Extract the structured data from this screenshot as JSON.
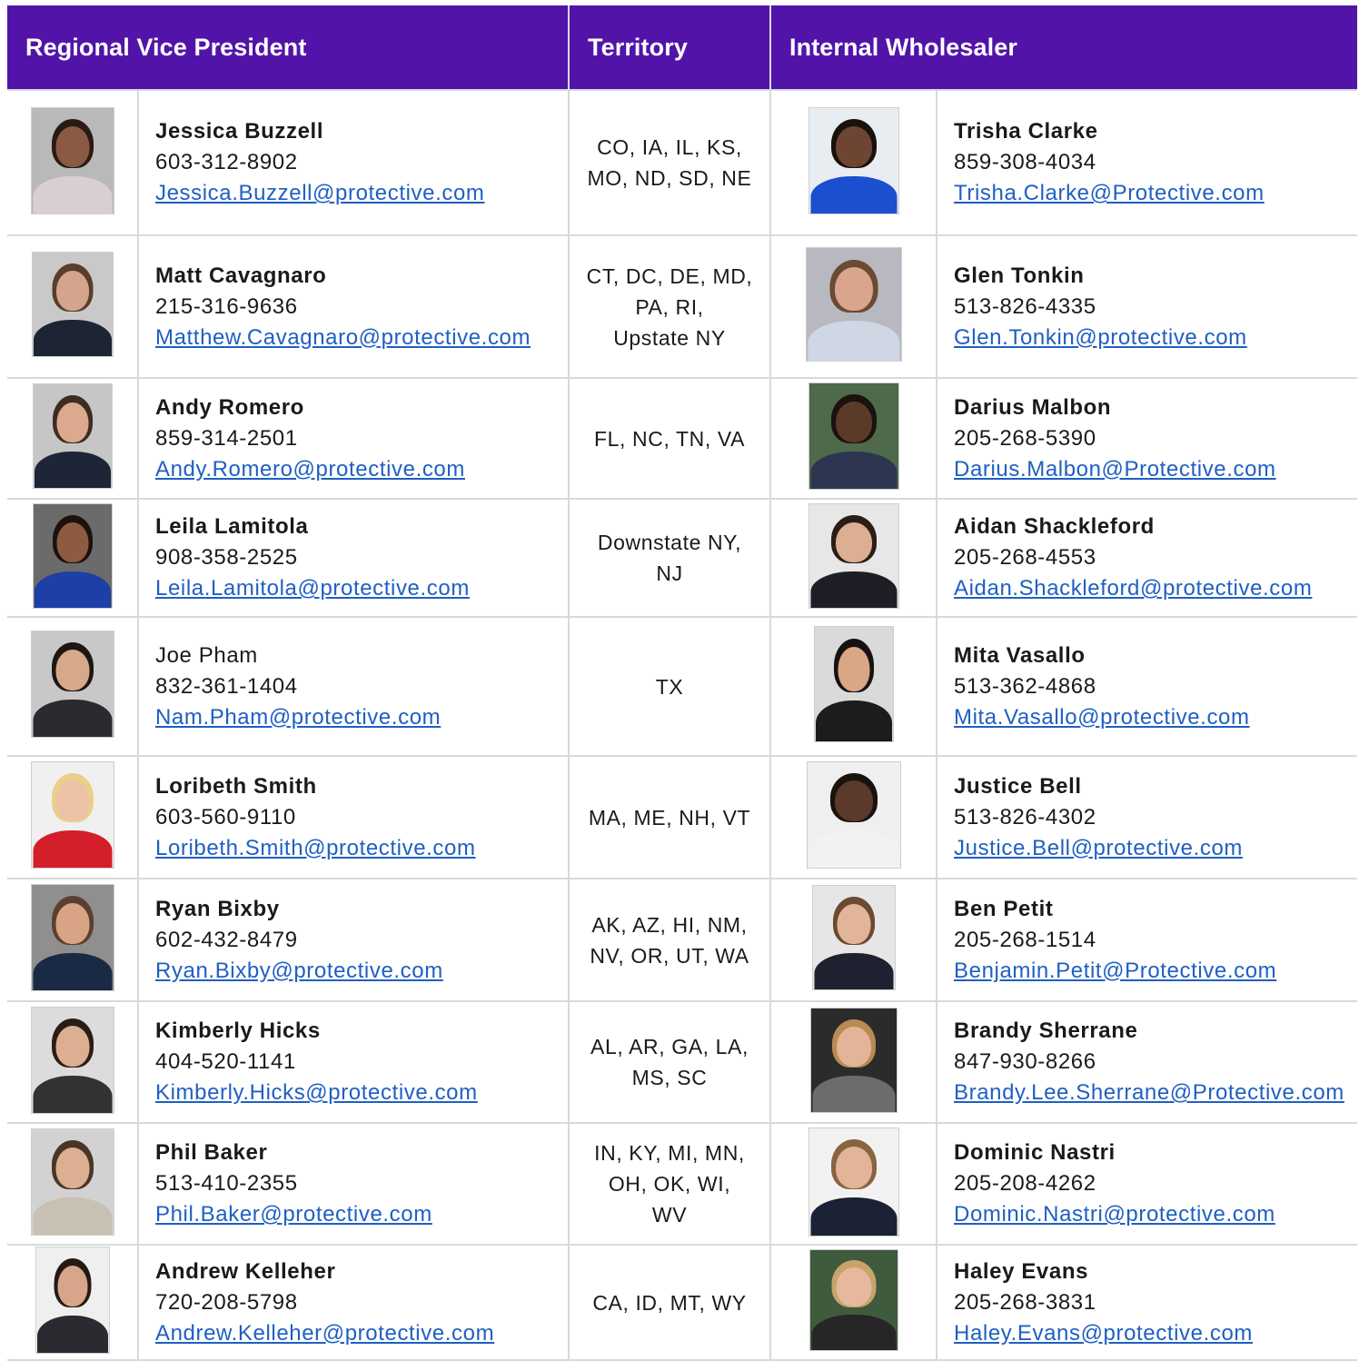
{
  "header": {
    "rvp": "Regional Vice President",
    "territory": "Territory",
    "iw": "Internal Wholesaler"
  },
  "rows": [
    {
      "rvp": {
        "name": "Jessica Buzzell",
        "phone": "603-312-8902",
        "email": "Jessica.Buzzell@protective.com"
      },
      "territory": [
        "CO, IA, IL, KS,",
        "MO, ND, SD, NE"
      ],
      "iw": {
        "name": "Trisha Clarke",
        "phone": "859-308-4034",
        "email": "Trisha.Clarke@Protective.com"
      }
    },
    {
      "rvp": {
        "name": "Matt Cavagnaro",
        "phone": "215-316-9636",
        "email": "Matthew.Cavagnaro@protective.com"
      },
      "territory": [
        "CT, DC, DE, MD,",
        "PA, RI,",
        "Upstate NY"
      ],
      "iw": {
        "name": "Glen Tonkin",
        "phone": "513-826-4335",
        "email": "Glen.Tonkin@protective.com"
      }
    },
    {
      "rvp": {
        "name": "Andy Romero",
        "phone": "859-314-2501",
        "email": "Andy.Romero@protective.com"
      },
      "territory": [
        "FL, NC, TN, VA"
      ],
      "iw": {
        "name": "Darius Malbon",
        "phone": "205-268-5390",
        "email": "Darius.Malbon@Protective.com"
      }
    },
    {
      "rvp": {
        "name": "Leila Lamitola",
        "phone": "908-358-2525",
        "email": "Leila.Lamitola@protective.com"
      },
      "territory": [
        "Downstate NY,",
        "NJ"
      ],
      "iw": {
        "name": "Aidan Shackleford",
        "phone": "205-268-4553",
        "email": "Aidan.Shackleford@protective.com"
      }
    },
    {
      "rvp": {
        "name": "Joe Pham",
        "phone": "832-361-1404",
        "email": "Nam.Pham@protective.com"
      },
      "territory": [
        "TX"
      ],
      "iw": {
        "name": "Mita Vasallo",
        "phone": "513-362-4868",
        "email": "Mita.Vasallo@protective.com"
      }
    },
    {
      "rvp": {
        "name": "Loribeth Smith",
        "phone": "603-560-9110",
        "email": "Loribeth.Smith@protective.com"
      },
      "territory": [
        "MA, ME, NH, VT"
      ],
      "iw": {
        "name": "Justice Bell",
        "phone": "513-826-4302",
        "email": "Justice.Bell@protective.com"
      }
    },
    {
      "rvp": {
        "name": "Ryan Bixby",
        "phone": "602-432-8479",
        "email": "Ryan.Bixby@protective.com"
      },
      "territory": [
        "AK, AZ, HI, NM,",
        "NV, OR, UT, WA"
      ],
      "iw": {
        "name": "Ben Petit",
        "phone": "205-268-1514",
        "email": "Benjamin.Petit@Protective.com"
      }
    },
    {
      "rvp": {
        "name": "Kimberly Hicks",
        "phone": "404-520-1141",
        "email": "Kimberly.Hicks@protective.com"
      },
      "territory": [
        "AL, AR, GA, LA,",
        "MS, SC"
      ],
      "iw": {
        "name": "Brandy Sherrane",
        "phone": "847-930-8266",
        "email": "Brandy.Lee.Sherrane@Protective.com"
      }
    },
    {
      "rvp": {
        "name": "Phil Baker",
        "phone": "513-410-2355",
        "email": "Phil.Baker@protective.com"
      },
      "territory": [
        "IN, KY, MI, MN,",
        "OH, OK, WI,",
        "WV"
      ],
      "iw": {
        "name": "Dominic Nastri",
        "phone": "205-208-4262",
        "email": "Dominic.Nastri@protective.com"
      }
    },
    {
      "rvp": {
        "name": "Andrew Kelleher",
        "phone": "720-208-5798",
        "email": "Andrew.Kelleher@protective.com"
      },
      "territory": [
        "CA, ID, MT, WY"
      ],
      "iw": {
        "name": "Haley Evans",
        "phone": "205-268-3831",
        "email": "Haley.Evans@protective.com"
      }
    }
  ]
}
